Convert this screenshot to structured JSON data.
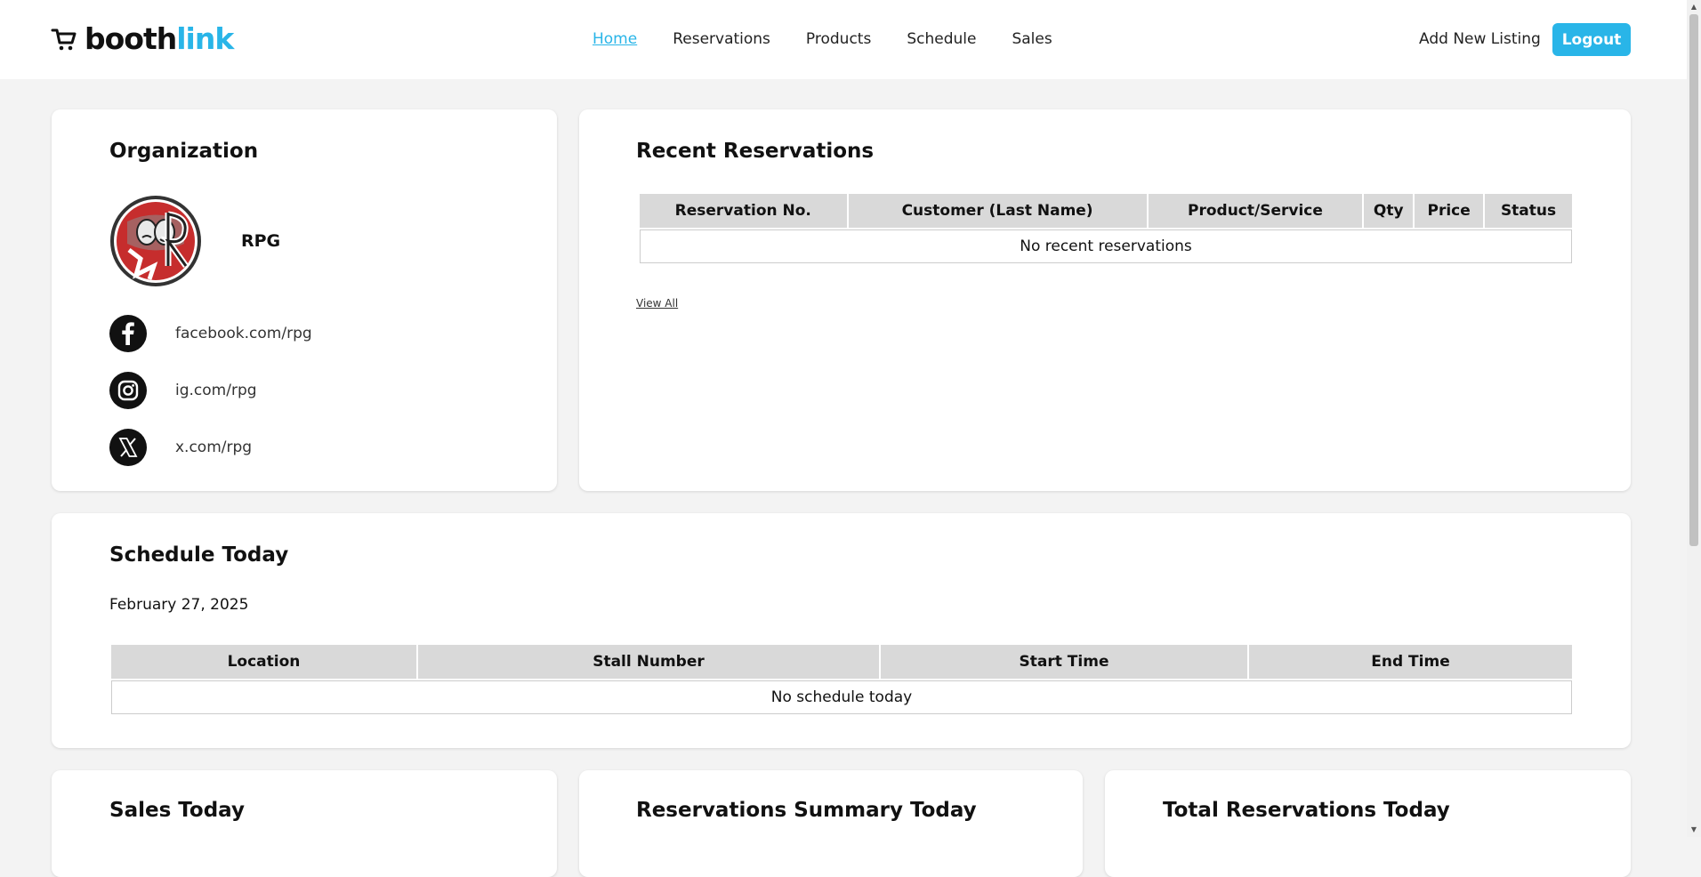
{
  "header": {
    "brand_part1": "booth",
    "brand_part2": "link",
    "nav": [
      {
        "label": "Home",
        "active": true
      },
      {
        "label": "Reservations"
      },
      {
        "label": "Products"
      },
      {
        "label": "Schedule"
      },
      {
        "label": "Sales"
      }
    ],
    "add_listing_label": "Add New Listing",
    "logout_label": "Logout",
    "accent_color": "#29b5e8"
  },
  "organization": {
    "title": "Organization",
    "name": "RPG",
    "socials": [
      {
        "icon": "facebook-icon",
        "label": "facebook.com/rpg"
      },
      {
        "icon": "instagram-icon",
        "label": "ig.com/rpg"
      },
      {
        "icon": "x-icon",
        "label": "x.com/rpg"
      }
    ]
  },
  "recent_reservations": {
    "title": "Recent Reservations",
    "columns": [
      "Reservation No.",
      "Customer (Last Name)",
      "Product/Service",
      "Qty",
      "Price",
      "Status"
    ],
    "empty_text": "No recent reservations",
    "view_all_label": "View All"
  },
  "schedule_today": {
    "title": "Schedule Today",
    "date": "February 27, 2025",
    "columns": [
      "Location",
      "Stall Number",
      "Start Time",
      "End Time"
    ],
    "empty_text": "No schedule today"
  },
  "sales_today": {
    "title": "Sales Today"
  },
  "reservations_summary": {
    "title": "Reservations Summary Today"
  },
  "total_reservations": {
    "title": "Total Reservations Today"
  }
}
